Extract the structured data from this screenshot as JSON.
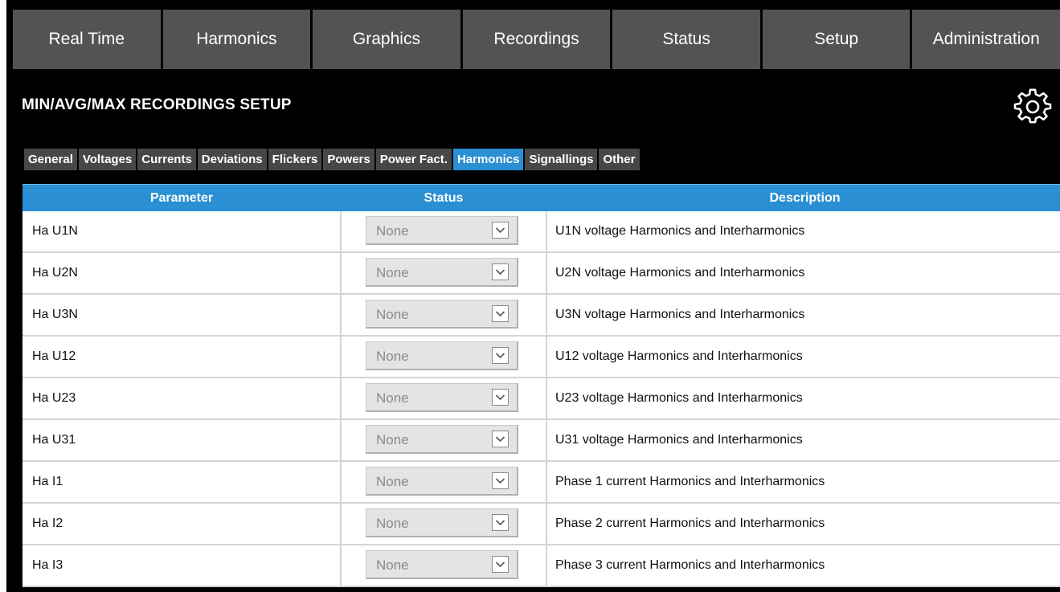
{
  "nav": {
    "tabs": [
      {
        "label": "Real Time"
      },
      {
        "label": "Harmonics"
      },
      {
        "label": "Graphics"
      },
      {
        "label": "Recordings"
      },
      {
        "label": "Status"
      },
      {
        "label": "Setup"
      },
      {
        "label": "Administration"
      }
    ]
  },
  "header": {
    "title": "MIN/AVG/MAX RECORDINGS SETUP",
    "settings_icon": "gear-icon"
  },
  "sub_tabs": {
    "active": "Harmonics",
    "items": [
      {
        "label": "General"
      },
      {
        "label": "Voltages"
      },
      {
        "label": "Currents"
      },
      {
        "label": "Deviations"
      },
      {
        "label": "Flickers"
      },
      {
        "label": "Powers"
      },
      {
        "label": "Power Fact."
      },
      {
        "label": "Harmonics"
      },
      {
        "label": "Signallings"
      },
      {
        "label": "Other"
      }
    ]
  },
  "table": {
    "headers": {
      "parameter": "Parameter",
      "status": "Status",
      "description": "Description"
    },
    "rows": [
      {
        "parameter": "Ha U1N",
        "status": "None",
        "description": "U1N voltage Harmonics and Interharmonics"
      },
      {
        "parameter": "Ha U2N",
        "status": "None",
        "description": "U2N voltage Harmonics and Interharmonics"
      },
      {
        "parameter": "Ha U3N",
        "status": "None",
        "description": "U3N voltage Harmonics and Interharmonics"
      },
      {
        "parameter": "Ha U12",
        "status": "None",
        "description": "U12 voltage Harmonics and Interharmonics"
      },
      {
        "parameter": "Ha U23",
        "status": "None",
        "description": "U23 voltage Harmonics and Interharmonics"
      },
      {
        "parameter": "Ha U31",
        "status": "None",
        "description": "U31 voltage Harmonics and Interharmonics"
      },
      {
        "parameter": "Ha I1",
        "status": "None",
        "description": "Phase 1 current Harmonics and Interharmonics"
      },
      {
        "parameter": "Ha I2",
        "status": "None",
        "description": "Phase 2 current Harmonics and Interharmonics"
      },
      {
        "parameter": "Ha I3",
        "status": "None",
        "description": "Phase 3 current Harmonics and Interharmonics"
      }
    ]
  },
  "colors": {
    "background": "#000000",
    "nav_tab": "#535353",
    "sub_tab": "#474747",
    "accent": "#2a8fd3",
    "select_bg": "#e4e4e4",
    "select_text": "#8a8a8a"
  }
}
